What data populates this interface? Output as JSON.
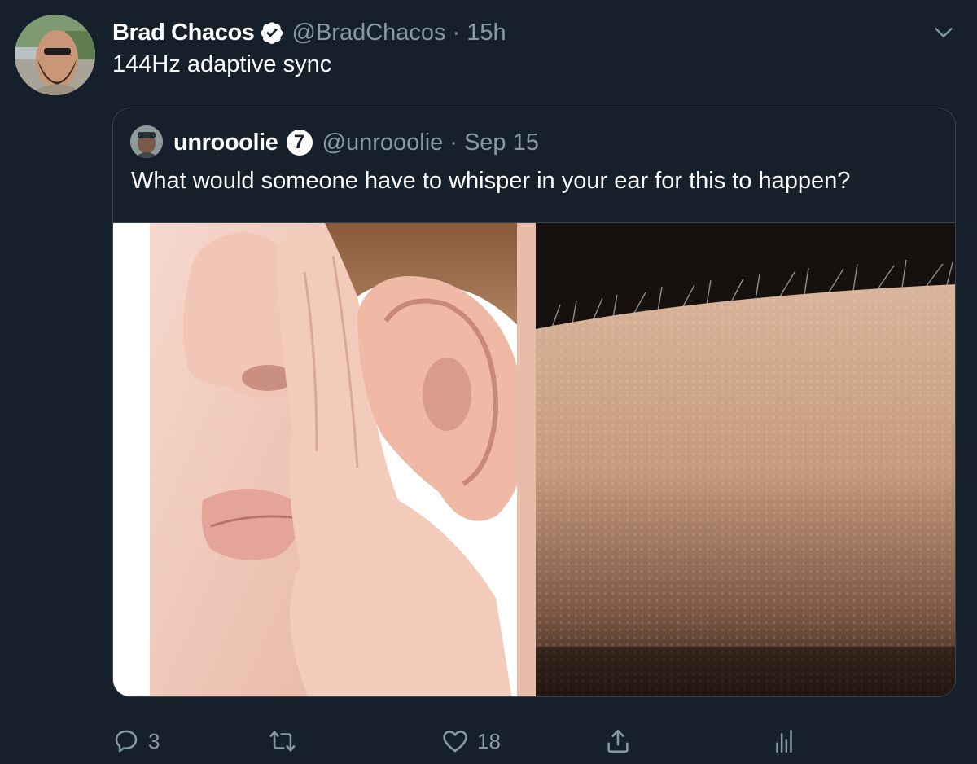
{
  "tweet": {
    "author": {
      "name": "Brad Chacos",
      "verified": true,
      "handle": "@BradChacos",
      "separator": "·",
      "time": "15h"
    },
    "text": "144Hz adaptive sync",
    "menu_icon": "chevron-down-icon"
  },
  "quoted_tweet": {
    "author": {
      "name": "unrooolie",
      "badge": "7",
      "handle": "@unrooolie",
      "separator": "·",
      "date": "Sep 15"
    },
    "text": "What would someone have to whisper in your ear for this to happen?",
    "media": [
      {
        "subject": "whisper-photo"
      },
      {
        "subject": "goosebumps-photo"
      }
    ]
  },
  "actions": {
    "reply": {
      "icon": "reply-icon",
      "count": "3"
    },
    "retweet": {
      "icon": "retweet-icon",
      "count": ""
    },
    "like": {
      "icon": "heart-icon",
      "count": "18"
    },
    "share": {
      "icon": "share-icon",
      "count": ""
    },
    "analytics": {
      "icon": "analytics-icon",
      "count": ""
    }
  },
  "colors": {
    "background": "#15202b",
    "text": "#ffffff",
    "secondary_text": "#8899a6",
    "border": "#38444d"
  }
}
